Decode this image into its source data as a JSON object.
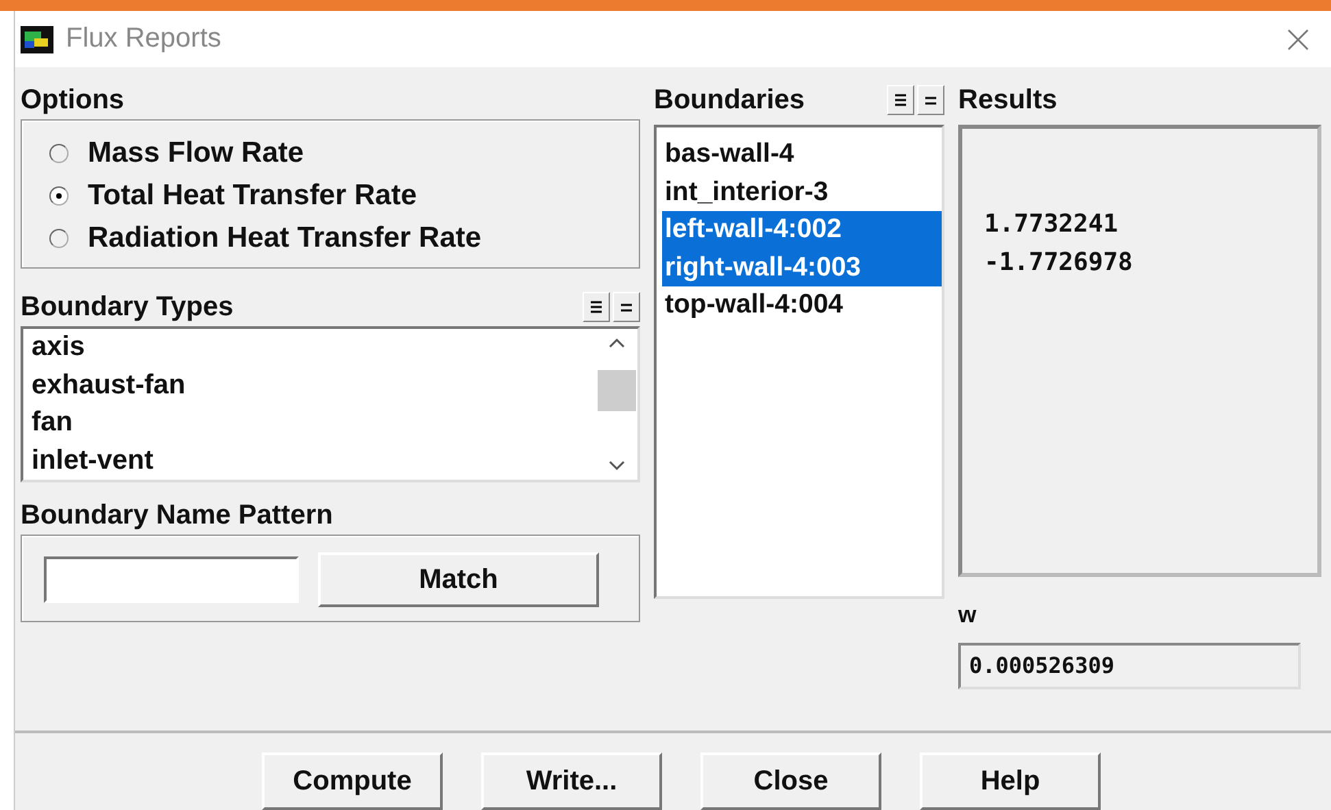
{
  "window": {
    "title": "Flux Reports"
  },
  "options": {
    "label": "Options",
    "radios": [
      {
        "label": "Mass Flow Rate",
        "selected": false
      },
      {
        "label": "Total Heat Transfer Rate",
        "selected": true
      },
      {
        "label": "Radiation Heat Transfer Rate",
        "selected": false
      }
    ]
  },
  "boundary_types": {
    "label": "Boundary Types",
    "items": [
      "axis",
      "exhaust-fan",
      "fan",
      "inlet-vent"
    ]
  },
  "name_pattern": {
    "label": "Boundary Name Pattern",
    "button": "Match"
  },
  "boundaries": {
    "label": "Boundaries",
    "items": [
      {
        "label": "bas-wall-4",
        "selected": false
      },
      {
        "label": "int_interior-3",
        "selected": false
      },
      {
        "label": "left-wall-4:002",
        "selected": true
      },
      {
        "label": "right-wall-4:003",
        "selected": true
      },
      {
        "label": "top-wall-4:004",
        "selected": false
      }
    ]
  },
  "results": {
    "label": "Results",
    "values": [
      "1.7732241",
      "-1.7726978"
    ]
  },
  "w": {
    "label": "w",
    "value": "0.000526309"
  },
  "buttons": [
    "Compute",
    "Write...",
    "Close",
    "Help"
  ]
}
